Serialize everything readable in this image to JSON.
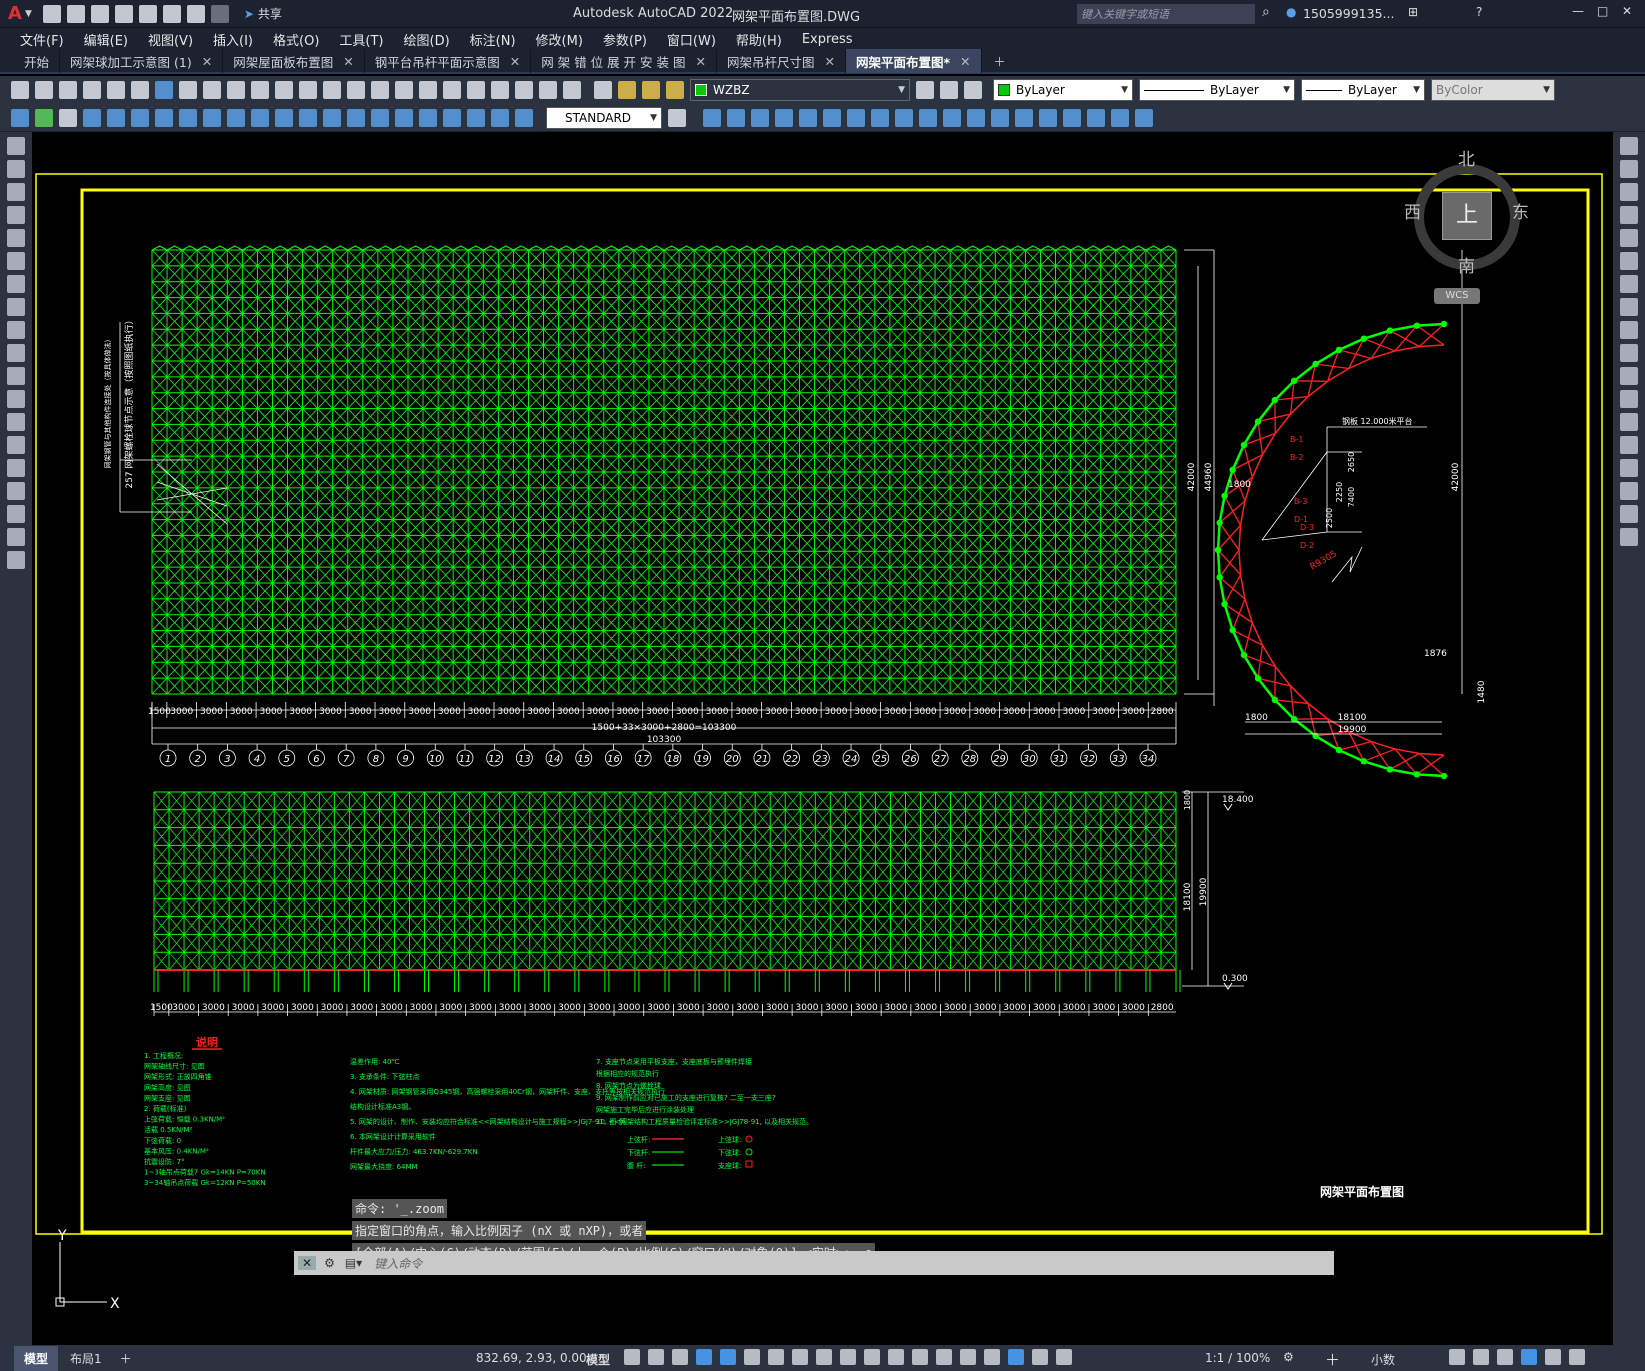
{
  "app": {
    "title": "Autodesk AutoCAD 2022",
    "filename": "网架平面布置图.DWG",
    "share_label": "共享",
    "search_placeholder": "键入关键字或短语",
    "user": "1505999135...",
    "logo": "A"
  },
  "menu": [
    "文件(F)",
    "编辑(E)",
    "视图(V)",
    "插入(I)",
    "格式(O)",
    "工具(T)",
    "绘图(D)",
    "标注(N)",
    "修改(M)",
    "参数(P)",
    "窗口(W)",
    "帮助(H)",
    "Express"
  ],
  "tabs": [
    {
      "label": "开始",
      "closable": false,
      "active": false
    },
    {
      "label": "网架球加工示意图 (1)",
      "closable": true,
      "active": false
    },
    {
      "label": "网架屋面板布置图",
      "closable": true,
      "active": false
    },
    {
      "label": "钢平台吊杆平面示意图",
      "closable": true,
      "active": false
    },
    {
      "label": "网 架 错 位 展 开 安 装 图",
      "closable": true,
      "active": false
    },
    {
      "label": "网架吊杆尺寸图",
      "closable": true,
      "active": false
    },
    {
      "label": "网架平面布置图*",
      "closable": true,
      "active": true
    }
  ],
  "toolbar": {
    "layer": "WZBZ",
    "color": "ByLayer",
    "linetype": "ByLayer",
    "lineweight": "ByLayer",
    "plotstyle": "ByColor",
    "textstyle": "STANDARD",
    "layer_color": "#00cc00"
  },
  "viewcube": {
    "north": "北",
    "south": "南",
    "east": "东",
    "west": "西",
    "top": "上",
    "wcs": "WCS"
  },
  "drawing": {
    "title": "网架平面布置图",
    "spacing_labels": [
      "1500",
      "3000",
      "3000",
      "3000",
      "3000",
      "3000",
      "3000",
      "3000",
      "3000",
      "3000",
      "3000",
      "3000",
      "3000",
      "3000",
      "3000",
      "3000",
      "3000",
      "3000",
      "3000",
      "3000",
      "3000",
      "3000",
      "3000",
      "3000",
      "3000",
      "3000",
      "3000",
      "3000",
      "3000",
      "3000",
      "3000",
      "3000",
      "3000",
      "3000",
      "2800"
    ],
    "total_formula": "1500+33×3000+2800=103300",
    "total_length": "103300",
    "axis_numbers": [
      "1",
      "2",
      "3",
      "4",
      "5",
      "6",
      "7",
      "8",
      "9",
      "10",
      "11",
      "12",
      "13",
      "14",
      "15",
      "16",
      "17",
      "18",
      "19",
      "20",
      "21",
      "22",
      "23",
      "24",
      "25",
      "26",
      "27",
      "28",
      "29",
      "30",
      "31",
      "32",
      "33",
      "34"
    ],
    "plan_dim_inner": "42000",
    "plan_dim_outer": "44960",
    "arch_dims": {
      "span_inner": "18100",
      "span_outer": "19900",
      "side": "1800",
      "side2": "1800",
      "right_h": "42000",
      "top_offset": "1876",
      "bottom_h": "1480",
      "radius": "R9305",
      "platform": "钢板 12.000米平台",
      "d1": "2650",
      "d2": "2250",
      "d3": "2500",
      "d4": "7400",
      "labels": [
        "B-1",
        "B-2",
        "B-3",
        "D-1",
        "D-2",
        "D-3"
      ]
    },
    "elev_dims": {
      "top_level": "18.400",
      "bottom_level": "0.300",
      "h1": "1800",
      "h2": "18100",
      "h3": "19900"
    },
    "note_vertical": "网架钢管与其他构件连接处（按具体做法）",
    "note_vertical2": "257 网架螺栓球节点示意（按照图纸执行）",
    "notes_title": "说明",
    "notes_col1": [
      "1. 工程概况:",
      "   网架轴线尺寸: 见图",
      "   网架形式: 正放四角锥",
      "   网架高度: 见图",
      "   网架支座: 见图",
      "2. 荷载(标准)",
      "   上弦荷载: 恒载 0.3KN/M²",
      "            活载 0.5KN/M²",
      "   下弦荷载: 0",
      "   基本风压: 0.4KN/M²",
      "   抗震设防: 7°",
      "   1~3轴吊点荷载7 Gk=14KN P=70KN",
      "   3~34轴吊点荷载 Gk=12KN P=50KN"
    ],
    "notes_col2": [
      "温差作用: 40℃",
      "3. 支承条件: 下弦柱点",
      "4. 网架材质: 网架钢管采用Q345钢，高强螺栓采用40Cr钢，网架杆件、支座、支托等按相关规范执行",
      "   结构设计标准A3钢。",
      "5. 网架的设计、制作、安装均应符合标准<<网架结构设计与施工规程>>JGJ7-91, <<网架结构工程质量检验评定标准>>JGJ78-91, 以及相关规范。",
      "6. 本网架设计计算采用软件",
      "   杆件最大应力/压力: 463.7KN/-629.7KN",
      "   网架最大挠度: 64MM"
    ],
    "notes_col3": [
      "7. 支座节点采用平板支座，支座底板与预埋件焊接",
      "   根据相应的规范执行",
      "8. 网架节点为螺栓球",
      "9. 网架制作前应对已施工的支座进行复核? 二至一支三座?",
      "   网架施工完毕后应进行涂装处理",
      "10. 图    例"
    ],
    "legend": [
      {
        "label": "上弦杆:",
        "sym": "上弦球:",
        "color": "#ff3030"
      },
      {
        "label": "下弦杆:",
        "sym": "下弦球:",
        "color": "#00dd00"
      },
      {
        "label": "腹  杆:",
        "sym": "支座球:",
        "color": "#00dd00"
      }
    ]
  },
  "command": {
    "history": [
      "命令: '_.zoom",
      "指定窗口的角点，输入比例因子 (nX 或 nXP)，或者",
      "[全部(A)/中心(C)/动态(D)/范围(E)/上一个(P)/比例(S)/窗口(W)/对象(O)] <实时>: _e"
    ],
    "placeholder": "键入命令"
  },
  "status": {
    "layout_tabs": [
      "模型",
      "布局1"
    ],
    "coords": "832.69, 2.93, 0.00",
    "mode": "模型",
    "scale": "1:1 / 100%",
    "units": "小数"
  },
  "colors": {
    "grid": "#00ff00",
    "frame": "#ffff00",
    "chord": "#ff2020",
    "dim": "#ffffff"
  }
}
